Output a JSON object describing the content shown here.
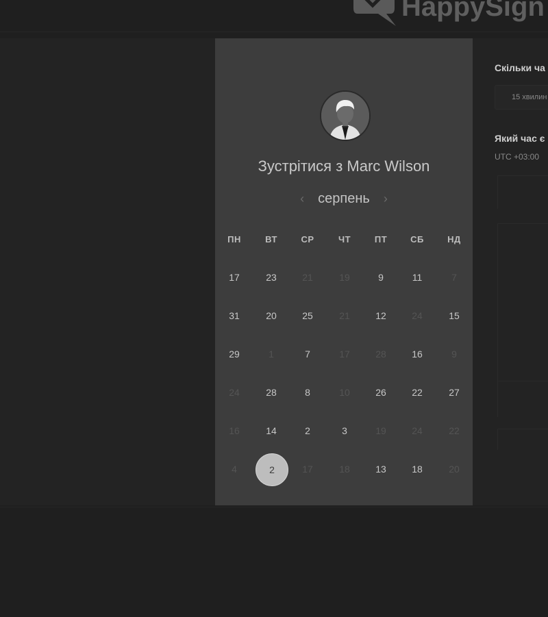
{
  "brand": {
    "name": "HappySign"
  },
  "scheduler": {
    "title": "Зустрітися з Marc Wilson",
    "month": "серпень",
    "prev_icon": "chevron-left-icon",
    "next_icon": "chevron-right-icon",
    "weekdays": [
      "ПН",
      "ВТ",
      "СР",
      "ЧТ",
      "ПТ",
      "СБ",
      "НД"
    ],
    "weeks": [
      [
        {
          "d": "17",
          "on": true
        },
        {
          "d": "23",
          "on": true
        },
        {
          "d": "21",
          "on": false
        },
        {
          "d": "19",
          "on": false
        },
        {
          "d": "9",
          "on": true
        },
        {
          "d": "11",
          "on": true
        },
        {
          "d": "7",
          "on": false
        }
      ],
      [
        {
          "d": "31",
          "on": true
        },
        {
          "d": "20",
          "on": true
        },
        {
          "d": "25",
          "on": true
        },
        {
          "d": "21",
          "on": false
        },
        {
          "d": "12",
          "on": true
        },
        {
          "d": "24",
          "on": false
        },
        {
          "d": "15",
          "on": true
        }
      ],
      [
        {
          "d": "29",
          "on": true
        },
        {
          "d": "1",
          "on": false
        },
        {
          "d": "7",
          "on": true
        },
        {
          "d": "17",
          "on": false
        },
        {
          "d": "28",
          "on": false
        },
        {
          "d": "16",
          "on": true
        },
        {
          "d": "9",
          "on": false
        }
      ],
      [
        {
          "d": "24",
          "on": false
        },
        {
          "d": "28",
          "on": true
        },
        {
          "d": "8",
          "on": true
        },
        {
          "d": "10",
          "on": false
        },
        {
          "d": "26",
          "on": true
        },
        {
          "d": "22",
          "on": true
        },
        {
          "d": "27",
          "on": true
        }
      ],
      [
        {
          "d": "16",
          "on": false
        },
        {
          "d": "14",
          "on": true
        },
        {
          "d": "2",
          "on": true
        },
        {
          "d": "3",
          "on": true
        },
        {
          "d": "19",
          "on": false
        },
        {
          "d": "24",
          "on": false
        },
        {
          "d": "22",
          "on": false
        }
      ],
      [
        {
          "d": "4",
          "on": false
        },
        {
          "d": "2",
          "on": true,
          "selected": true
        },
        {
          "d": "17",
          "on": false
        },
        {
          "d": "18",
          "on": false
        },
        {
          "d": "13",
          "on": true
        },
        {
          "d": "18",
          "on": true
        },
        {
          "d": "20",
          "on": false
        }
      ]
    ]
  },
  "right_panel": {
    "duration_label": "Скільки ча",
    "duration_value": "15 хвилин",
    "time_label": "Який час є",
    "timezone": "UTC +03:00"
  }
}
